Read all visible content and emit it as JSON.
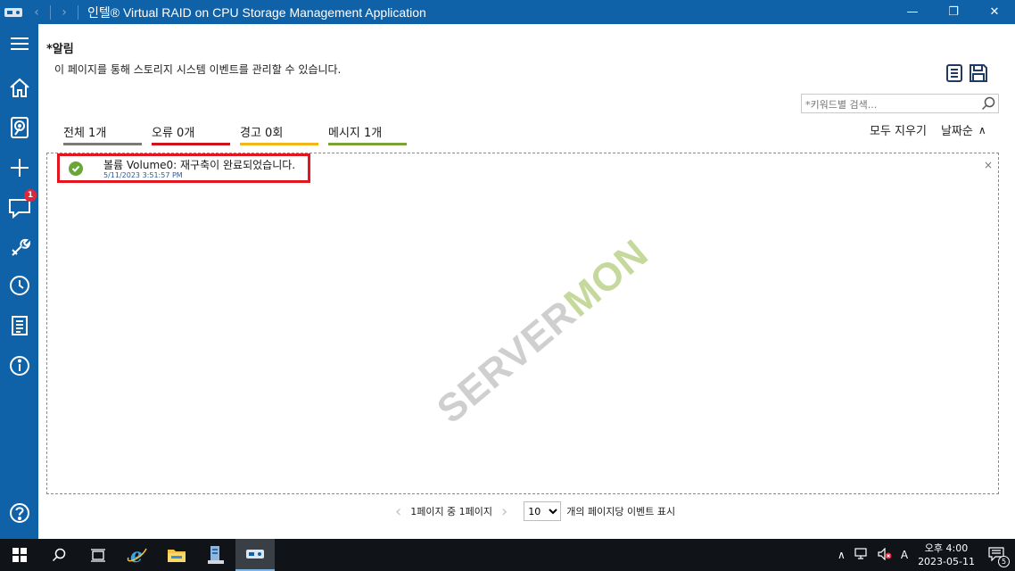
{
  "window": {
    "title": "인텔® Virtual RAID on CPU Storage Management Application",
    "back_glyph": "‹",
    "forward_glyph": "›",
    "minimize": "—",
    "maximize": "❐",
    "close": "✕"
  },
  "sidebar": {
    "items": [
      {
        "name": "menu",
        "icon": "hamburger-icon"
      },
      {
        "name": "home",
        "icon": "home-icon"
      },
      {
        "name": "storage",
        "icon": "disk-icon"
      },
      {
        "name": "create",
        "icon": "plus-icon"
      },
      {
        "name": "alerts",
        "icon": "chat-icon",
        "badge": "1"
      },
      {
        "name": "settings",
        "icon": "wrench-icon"
      },
      {
        "name": "history",
        "icon": "clock-icon"
      },
      {
        "name": "report",
        "icon": "document-icon"
      },
      {
        "name": "info",
        "icon": "info-icon"
      },
      {
        "name": "help",
        "icon": "help-icon"
      }
    ]
  },
  "page": {
    "title": "*알림",
    "description": "이 페이지를 통해 스토리지 시스템 이벤트를 관리할 수 있습니다."
  },
  "search": {
    "placeholder": "*키워드별 검색..."
  },
  "filters": [
    {
      "label": "전체 1개",
      "color": "#7a7a7a"
    },
    {
      "label": "오류 0개",
      "color": "#d0121c"
    },
    {
      "label": "경고 0회",
      "color": "#f2b51a"
    },
    {
      "label": "메시지 1개",
      "color": "#7aa237"
    }
  ],
  "actions": {
    "clear_all": "모두 지우기",
    "sort": "날짜순",
    "sort_chevron": "∧"
  },
  "alerts": [
    {
      "message": "볼륨 Volume0: 재구축이 완료되었습니다.",
      "timestamp": "5/11/2023 3:51:57 PM",
      "status": "success"
    }
  ],
  "list": {
    "close_glyph": "×"
  },
  "watermark": {
    "part1": "SERVER",
    "part2": "MON"
  },
  "pagination": {
    "info": "1페이지 중 1페이지",
    "per_page": "10",
    "per_page_label": "개의 페이지당 이벤트 표시",
    "prev": "‹",
    "next": "›"
  },
  "taskbar": {
    "items": [
      "start-icon",
      "search-icon",
      "task-view-icon",
      "ie-icon",
      "file-explorer-icon",
      "server-manager-icon",
      "raid-app-icon"
    ],
    "tray": {
      "chevron": "∧",
      "ime": "A",
      "time": "오후 4:00",
      "date": "2023-05-11",
      "notifications": "5"
    }
  },
  "colors": {
    "accent": "#0f62a8",
    "badge": "#e0263b",
    "highlight_border": "#e3151f",
    "success": "#6aa637"
  }
}
